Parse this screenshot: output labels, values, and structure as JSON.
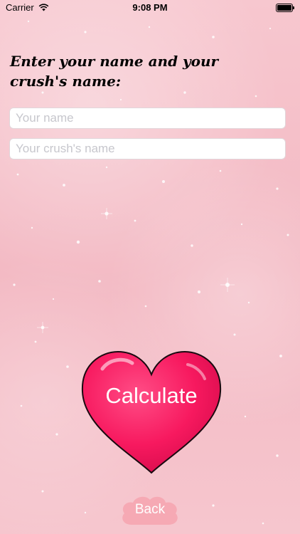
{
  "status_bar": {
    "carrier": "Carrier",
    "time": "9:08 PM",
    "wifi_icon": "wifi-icon",
    "battery_icon": "battery-icon"
  },
  "heading": {
    "line1": "Enter your name and your",
    "line2": "crush's name:"
  },
  "form": {
    "your_name": {
      "value": "",
      "placeholder": "Your name"
    },
    "crush_name": {
      "value": "",
      "placeholder": "Your crush's name"
    }
  },
  "calculate_button": {
    "label": "Calculate",
    "color": "#f7195f",
    "icon": "heart-icon"
  },
  "back_button": {
    "label": "Back",
    "color": "#f6a9b4",
    "icon": "cloud-icon"
  },
  "background": {
    "color": "#f6c3cb",
    "pattern": "pink-sparkles"
  }
}
